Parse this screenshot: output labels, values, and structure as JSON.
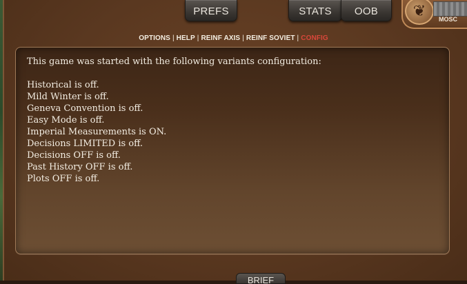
{
  "tabs": {
    "prefs": "PREFS",
    "stats": "STATS",
    "oob": "OOB",
    "brief": "BRIEF"
  },
  "corner": {
    "label": "MOSC"
  },
  "menu": {
    "options": "OPTIONS",
    "help": "HELP",
    "reinf_axis": "REINF AXIS",
    "reinf_soviet": "REINF SOVIET",
    "config": "CONFIG",
    "separator": "|",
    "active_color": "#d9473a"
  },
  "config": {
    "intro": "This game was started with the following variants configuration:",
    "lines": [
      "Historical is off.",
      "Mild Winter is off.",
      "Geneva Convention is off.",
      "Easy Mode is off.",
      "Imperial Measurements is ON.",
      "Decisions LIMITED is off.",
      "Decisions OFF is off.",
      "Past History OFF is off.",
      "Plots OFF is off."
    ]
  }
}
